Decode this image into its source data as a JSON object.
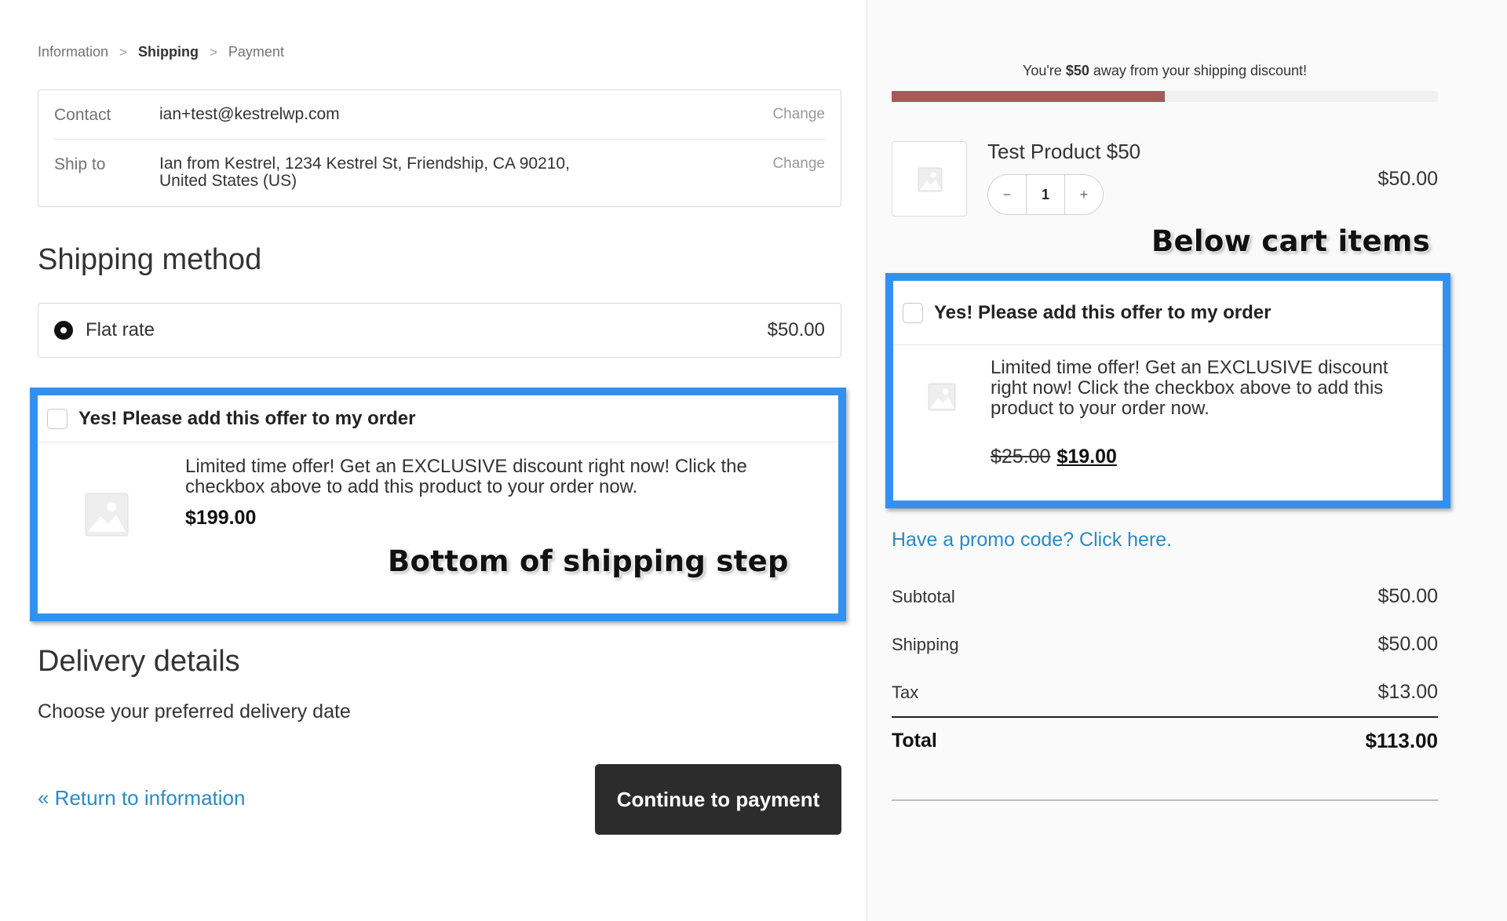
{
  "breadcrumb": {
    "items": [
      "Information",
      "Shipping",
      "Payment"
    ],
    "separator": ">"
  },
  "review": {
    "contact_label": "Contact",
    "contact_value": "ian+test@kestrelwp.com",
    "ship_label": "Ship to",
    "ship_value_line1": "Ian from Kestrel, 1234 Kestrel St, Friendship, CA 90210,",
    "ship_value_line2": "United States (US)",
    "change_label": "Change"
  },
  "shipping_method": {
    "heading": "Shipping method",
    "option_label": "Flat rate",
    "option_price": "$50.00",
    "selected": true
  },
  "offer_main": {
    "checkbox_label": "Yes! Please add this offer to my order",
    "description": "Limited time offer! Get an EXCLUSIVE discount right now! Click the checkbox above to add this product to your order now.",
    "price": "$199.00",
    "checked": false
  },
  "annotations": {
    "bottom_of_shipping": "Bottom of shipping step",
    "below_cart": "Below cart items"
  },
  "delivery": {
    "heading": "Delivery details",
    "subtitle": "Choose your preferred delivery date"
  },
  "footer": {
    "return_link": "« Return to information",
    "continue_button": "Continue to payment"
  },
  "sidebar": {
    "notice_prefix": "You're ",
    "notice_amount": "$50",
    "notice_suffix": " away from your shipping discount!",
    "progress_fraction": 0.5,
    "progress_color": "#a85858",
    "cart_item": {
      "name": "Test Product $50",
      "quantity": "1",
      "price": "$50.00",
      "minus": "−",
      "plus": "+"
    },
    "offer": {
      "checkbox_label": "Yes! Please add this offer to my order",
      "description": "Limited time offer! Get an EXCLUSIVE discount right now! Click the checkbox above to add this product to your order now.",
      "old_price": "$25.00",
      "new_price": "$19.00",
      "checked": false
    },
    "promo_link": "Have a promo code? Click here.",
    "totals": {
      "subtotal_label": "Subtotal",
      "subtotal": "$50.00",
      "shipping_label": "Shipping",
      "shipping": "$50.00",
      "tax_label": "Tax",
      "tax": "$13.00",
      "total_label": "Total",
      "total": "$113.00"
    }
  },
  "colors": {
    "highlight_frame": "#3291f0",
    "link": "#2b8ac6",
    "button_bg": "#2c2c2c"
  }
}
